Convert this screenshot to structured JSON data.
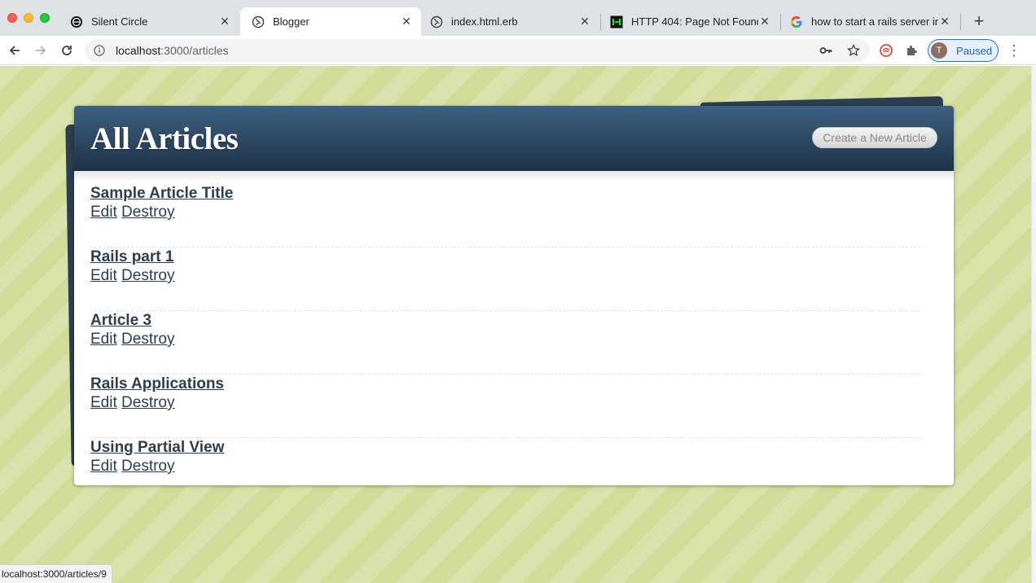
{
  "browser": {
    "tabs": [
      {
        "title": "Silent Circle",
        "icon": "silent-circle-icon",
        "active": false
      },
      {
        "title": "Blogger",
        "icon": "globe-icon",
        "active": true
      },
      {
        "title": "index.html.erb",
        "icon": "globe-icon",
        "active": false
      },
      {
        "title": "HTTP 404: Page Not Found",
        "icon": "hackernoon-icon",
        "active": false
      },
      {
        "title": "how to start a rails server in",
        "icon": "google-icon",
        "active": false
      }
    ],
    "url_host": "localhost",
    "url_path": ":3000/articles",
    "profile_initial": "T",
    "profile_label": "Paused",
    "status_url": "localhost:3000/articles/9"
  },
  "page": {
    "heading": "All Articles",
    "new_article_label": "Create a New Article",
    "edit_label": "Edit",
    "destroy_label": "Destroy",
    "articles": [
      {
        "title": "Sample Article Title"
      },
      {
        "title": "Rails part 1"
      },
      {
        "title": "Article 3"
      },
      {
        "title": "Rails Applications"
      },
      {
        "title": "Using Partial View"
      }
    ]
  },
  "colors": {
    "header_dark": "#1e3248",
    "header_light": "#3d6182",
    "link": "#2c3e50",
    "background": "#d0dc98",
    "profile_accent": "#1a73e8"
  }
}
